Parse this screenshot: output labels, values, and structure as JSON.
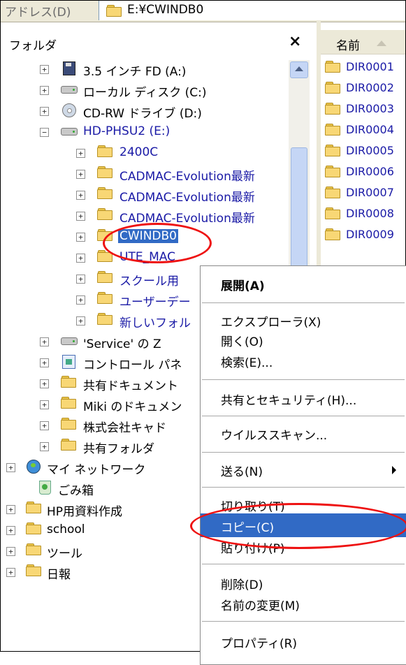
{
  "address": {
    "label": "アドレス(D)",
    "path": "E:¥CWINDB0"
  },
  "folders": {
    "title": "フォルダ",
    "close": "×"
  },
  "list": {
    "header": "名前"
  },
  "tree": [
    "3.5 インチ FD (A:)",
    "ローカル ディスク (C:)",
    "CD-RW ドライブ (D:)",
    "HD-PHSU2 (E:)",
    "2400C",
    "CADMAC-Evolution最新",
    "CADMAC-Evolution最新",
    "CADMAC-Evolution最新",
    "CWINDB0",
    "UTE_MAC",
    "スクール用",
    "ユーザーデー",
    "新しいフォル",
    "'Service' の Z",
    "コントロール パネ",
    "共有ドキュメント",
    "Miki のドキュメン",
    "株式会社キャド",
    "共有フォルダ",
    "マイ ネットワーク",
    "ごみ箱",
    "HP用資料作成",
    "school",
    "ツール",
    "日報"
  ],
  "files": [
    "DIR0001",
    "DIR0002",
    "DIR0003",
    "DIR0004",
    "DIR0005",
    "DIR0006",
    "DIR0007",
    "DIR0008",
    "DIR0009"
  ],
  "menu": {
    "expand": "展開(A)",
    "explorer": "エクスプローラ(X)",
    "open": "開く(O)",
    "search": "検索(E)...",
    "sharing": "共有とセキュリティ(H)...",
    "virus": "ウイルススキャン...",
    "sendto": "送る(N)",
    "cut": "切り取り(T)",
    "copy": "コピー(C)",
    "paste": "貼り付け(P)",
    "delete": "削除(D)",
    "rename": "名前の変更(M)",
    "properties": "プロパティ(R)"
  },
  "colors": {
    "selection": "#316ac5",
    "annotation": "#e11111",
    "link_blue": "#1a1aa6"
  }
}
